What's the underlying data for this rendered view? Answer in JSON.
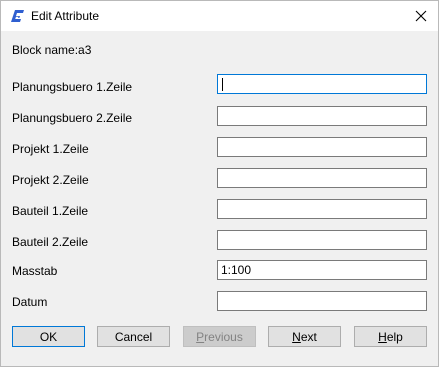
{
  "window": {
    "title": "Edit Attribute"
  },
  "block_name": "Block name:a3",
  "fields": [
    {
      "label": "Planungsbuero 1.Zeile",
      "value": ""
    },
    {
      "label": "Planungsbuero 2.Zeile",
      "value": ""
    },
    {
      "label": "Projekt 1.Zeile",
      "value": ""
    },
    {
      "label": "Projekt 2.Zeile",
      "value": ""
    },
    {
      "label": "Bauteil 1.Zeile",
      "value": ""
    },
    {
      "label": "Bauteil 2.Zeile",
      "value": ""
    },
    {
      "label": "Masstab",
      "value": "1:100"
    },
    {
      "label": "Datum",
      "value": ""
    }
  ],
  "buttons": {
    "ok": "OK",
    "cancel": "Cancel",
    "previous": {
      "first": "P",
      "rest": "revious"
    },
    "next": {
      "first": "N",
      "rest": "ext"
    },
    "help": {
      "first": "H",
      "rest": "elp"
    }
  },
  "colors": {
    "focus": "#0078d7",
    "app_icon": "#2f5fd0"
  },
  "icons": {
    "app": "app-logo-icon",
    "close": "close-icon"
  }
}
